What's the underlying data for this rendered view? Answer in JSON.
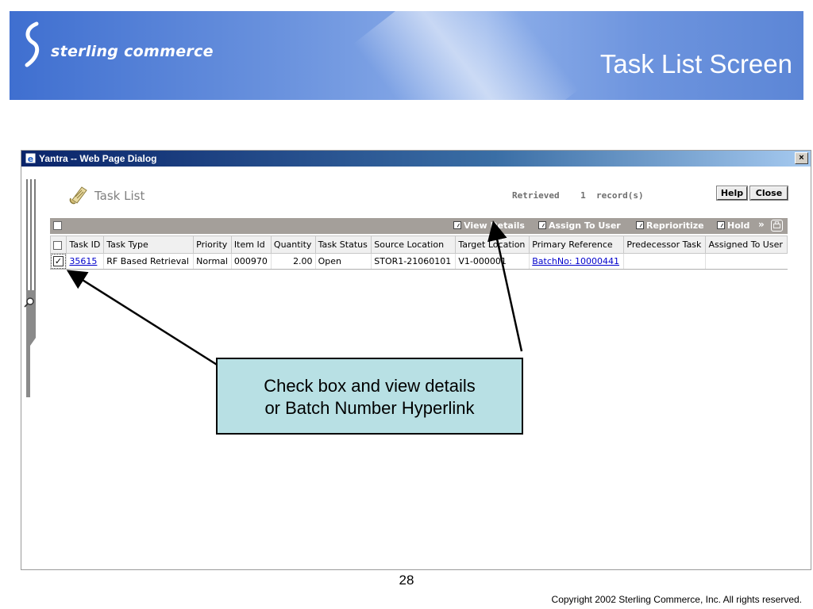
{
  "slide": {
    "brand": "sterling commerce",
    "title": "Task List Screen",
    "page_number": "28",
    "copyright": "Copyright 2002 Sterling Commerce, Inc. All rights reserved."
  },
  "dialog": {
    "window_title": "Yantra -- Web Page Dialog",
    "close_glyph": "×",
    "heading": "Task List",
    "retrieved_label": "Retrieved",
    "retrieved_count": "1",
    "retrieved_suffix": "record(s)",
    "help_label": "Help",
    "close_label": "Close"
  },
  "actions": {
    "view_details": "View Details",
    "assign_to_user": "Assign To User",
    "reprioritize": "Reprioritize",
    "hold": "Hold",
    "more": "»"
  },
  "table": {
    "columns": [
      "Task ID",
      "Task Type",
      "Priority",
      "Item Id",
      "Quantity",
      "Task Status",
      "Source Location",
      "Target Location",
      "Primary Reference",
      "Predecessor Task",
      "Assigned To User"
    ],
    "rows": [
      {
        "checked": true,
        "task_id": "35615",
        "task_type": "RF Based Retrieval",
        "priority": "Normal",
        "item_id": "000970",
        "quantity": "2.00",
        "task_status": "Open",
        "source_location": "STOR1-21060101",
        "target_location": "V1-000001",
        "primary_reference": "BatchNo: 10000441",
        "predecessor_task": "",
        "assigned_to_user": ""
      }
    ]
  },
  "callout": {
    "line1": "Check box and view details",
    "line2": "or Batch Number Hyperlink"
  },
  "colors": {
    "banner": "#5c86d6",
    "action_bar": "#a49f9a",
    "callout_fill": "#b8e0e4",
    "link": "#0000cc"
  },
  "icons": {
    "logo": "sterling-s-logo-icon",
    "task_list": "scroll-icon",
    "action": "action-arrow-icon",
    "print": "print-icon"
  }
}
